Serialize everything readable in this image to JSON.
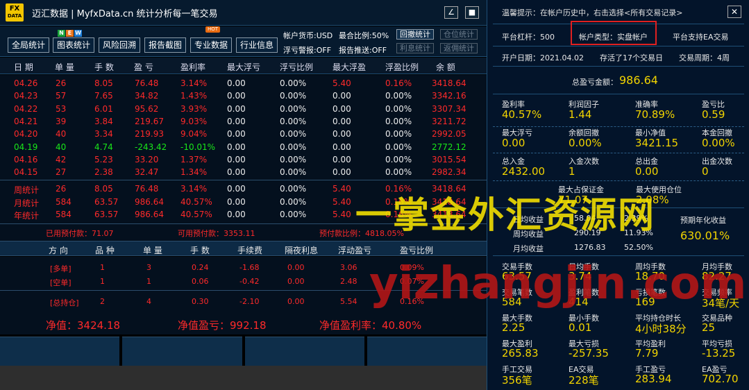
{
  "app": {
    "logo_top": "FX",
    "logo_bottom": "DATA",
    "title": "迈汇数据 | MyfxData.cn   统计分析每一笔交易",
    "minimize_label": "∠",
    "maximize_label": "■"
  },
  "toolbar": {
    "buttons": [
      "全局统计",
      "图表统计",
      "风险回溯",
      "报告截图",
      "专业数据",
      "行业信息"
    ],
    "new_letters": [
      "N",
      "E",
      "W"
    ],
    "new_colors": [
      "#1aa33a",
      "#e8731a",
      "#1f7fd8"
    ],
    "hot_label": "HOT",
    "info": {
      "currency": "帐户货币:USD",
      "max_ratio": "最合比例:50%",
      "float_alert": "浮亏警报:OFF",
      "report_push": "报告推送:OFF"
    },
    "side_buttons": [
      "回撤统计",
      "仓位统计",
      "利息统计",
      "返佣统计"
    ]
  },
  "daily_table": {
    "headers": [
      "日 期",
      "单 量",
      "手 数",
      "盈 亏",
      "盈利率",
      "最大浮亏",
      "浮亏比例",
      "最大浮盈",
      "浮盈比例",
      "余 额"
    ],
    "rows": [
      [
        "04.26",
        "26",
        "8.05",
        "76.48",
        "3.14%",
        "0.00",
        "0.00%",
        "5.40",
        "0.16%",
        "3418.64"
      ],
      [
        "04.23",
        "57",
        "7.65",
        "34.82",
        "1.43%",
        "0.00",
        "0.00%",
        "0.00",
        "0.00%",
        "3342.16"
      ],
      [
        "04.22",
        "53",
        "6.01",
        "95.62",
        "3.93%",
        "0.00",
        "0.00%",
        "0.00",
        "0.00%",
        "3307.34"
      ],
      [
        "04.21",
        "39",
        "3.84",
        "219.67",
        "9.03%",
        "0.00",
        "0.00%",
        "0.00",
        "0.00%",
        "3211.72"
      ],
      [
        "04.20",
        "40",
        "3.34",
        "219.93",
        "9.04%",
        "0.00",
        "0.00%",
        "0.00",
        "0.00%",
        "2992.05"
      ],
      [
        "04.19",
        "40",
        "4.74",
        "-243.42",
        "-10.01%",
        "0.00",
        "0.00%",
        "0.00",
        "0.00%",
        "2772.12"
      ],
      [
        "04.16",
        "42",
        "5.23",
        "33.20",
        "1.37%",
        "0.00",
        "0.00%",
        "0.00",
        "0.00%",
        "3015.54"
      ],
      [
        "04.15",
        "27",
        "2.38",
        "32.47",
        "1.34%",
        "0.00",
        "0.00%",
        "0.00",
        "0.00%",
        "2982.34"
      ]
    ],
    "totals": [
      [
        "周统计",
        "26",
        "8.05",
        "76.48",
        "3.14%",
        "0.00",
        "0.00%",
        "5.40",
        "0.16%",
        "3418.64"
      ],
      [
        "月统计",
        "584",
        "63.57",
        "986.64",
        "40.57%",
        "0.00",
        "0.00%",
        "5.40",
        "0.16%",
        "3418.64"
      ],
      [
        "年统计",
        "584",
        "63.57",
        "986.64",
        "40.57%",
        "0.00",
        "0.00%",
        "5.40",
        "0.16%",
        "3418.64"
      ]
    ],
    "summary": {
      "used_margin": "已用预付款：71.07",
      "free_margin": "可用预付款：3353.11",
      "margin_ratio": "预付款比例：4818.05%"
    }
  },
  "positions": {
    "headers": [
      "方 向",
      "品 种",
      "单 量",
      "手 数",
      "手续费",
      "隔夜利息",
      "浮动盈亏",
      "盈亏比例"
    ],
    "rows": [
      [
        "[多单]",
        "1",
        "3",
        "0.24",
        "-1.68",
        "0.00",
        "3.06",
        "0.09%"
      ],
      [
        "[空单]",
        "1",
        "1",
        "0.06",
        "-0.42",
        "0.00",
        "2.48",
        "0.07%"
      ],
      [
        "[总持仓]",
        "2",
        "4",
        "0.30",
        "-2.10",
        "0.00",
        "5.54",
        "0.16%"
      ]
    ],
    "net_value": "净值：3424.18",
    "net_pnl": "净值盈亏：992.18",
    "net_rate": "净值盈利率：40.80%"
  },
  "panel": {
    "hint": "温馨提示：在帐户历史中，右击选择<所有交易记录>",
    "close_label": "✕",
    "leverage": "平台杠杆：500",
    "account_type": "帐户类型：实盘帐户",
    "ea_support": "平台支持EA交易",
    "open_date": "开户日期：2021.04.02",
    "days_alive": "存活了17个交易日",
    "trade_cycle": "交易周期：4周",
    "total_pnl_label": "总盈亏金额：",
    "total_pnl_value": "986.64",
    "stats1": [
      {
        "label": "盈利率",
        "value": "40.57%"
      },
      {
        "label": "利润因子",
        "value": "1.44"
      },
      {
        "label": "准确率",
        "value": "70.89%"
      },
      {
        "label": "盈亏比",
        "value": "0.59"
      },
      {
        "label": "最大浮亏",
        "value": "0.00"
      },
      {
        "label": "余额回撤",
        "value": "0.00%"
      },
      {
        "label": "最小净值",
        "value": "3421.15"
      },
      {
        "label": "本金回撤",
        "value": "0.00%"
      },
      {
        "label": "总入金",
        "value": "2432.00"
      },
      {
        "label": "入金次数",
        "value": "1"
      },
      {
        "label": "总出金",
        "value": "0.00"
      },
      {
        "label": "出金次数",
        "value": "0"
      }
    ],
    "max_margin_label": "最大占保证金",
    "max_margin_value": "71.07",
    "max_position_label": "最大使用仓位",
    "max_position_value": "2.08%",
    "returns": [
      {
        "label": "日均收益",
        "value": "58.04",
        "pct": "2.39%"
      },
      {
        "label": "周均收益",
        "value": "290.19",
        "pct": "11.93%"
      },
      {
        "label": "月均收益",
        "value": "1276.83",
        "pct": "52.50%"
      }
    ],
    "annual_label": "预期年化收益",
    "annual_value": "630.01%",
    "stats2": [
      {
        "label": "交易手数",
        "value": "63.57"
      },
      {
        "label": "日均手数",
        "value": "3.74"
      },
      {
        "label": "周均手数",
        "value": "18.70"
      },
      {
        "label": "月均手数",
        "value": "82.27"
      },
      {
        "label": "交易笔数",
        "value": "584"
      },
      {
        "label": "盈利笔数",
        "value": "414"
      },
      {
        "label": "亏损笔数",
        "value": "169"
      },
      {
        "label": "交易频率",
        "value": "34笔/天"
      },
      {
        "label": "最大手数",
        "value": "2.25"
      },
      {
        "label": "最小手数",
        "value": "0.01"
      },
      {
        "label": "平均持仓时长",
        "value": "4小时38分"
      },
      {
        "label": "交易品种",
        "value": "25"
      },
      {
        "label": "最大盈利",
        "value": "265.83"
      },
      {
        "label": "最大亏损",
        "value": "-257.35"
      },
      {
        "label": "平均盈利",
        "value": "7.79"
      },
      {
        "label": "平均亏损",
        "value": "-13.25"
      },
      {
        "label": "手工交易",
        "value": "356笔"
      },
      {
        "label": "EA交易",
        "value": "228笔"
      },
      {
        "label": "手工盈亏",
        "value": "283.94"
      },
      {
        "label": "EA盈亏",
        "value": "702.70"
      }
    ]
  },
  "watermark": {
    "line1": "一掌金外汇资源网",
    "line2": "yizhangjin.com"
  }
}
